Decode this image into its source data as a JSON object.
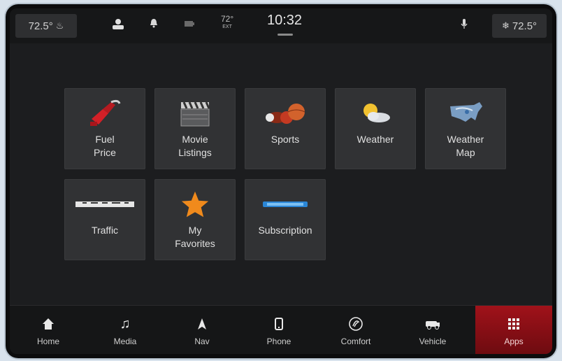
{
  "status": {
    "left_climate_temp": "72.5°",
    "right_climate_temp": "72.5°",
    "outside_temp": "72°",
    "outside_temp_unit": "EXT",
    "time": "10:32"
  },
  "apps": [
    {
      "label": "Fuel\nPrice",
      "icon": "fuel-nozzle-icon"
    },
    {
      "label": "Movie\nListings",
      "icon": "clapperboard-icon"
    },
    {
      "label": "Sports",
      "icon": "sports-balls-icon"
    },
    {
      "label": "Weather",
      "icon": "sun-cloud-icon"
    },
    {
      "label": "Weather\nMap",
      "icon": "us-map-icon"
    },
    {
      "label": "Traffic",
      "icon": "traffic-logo-icon"
    },
    {
      "label": "My\nFavorites",
      "icon": "star-icon"
    },
    {
      "label": "Subscription",
      "icon": "siriusxm-logo-icon"
    }
  ],
  "nav": [
    {
      "label": "Home",
      "icon": "home-icon"
    },
    {
      "label": "Media",
      "icon": "music-note-icon"
    },
    {
      "label": "Nav",
      "icon": "navigation-arrow-icon"
    },
    {
      "label": "Phone",
      "icon": "phone-icon"
    },
    {
      "label": "Comfort",
      "icon": "comfort-icon"
    },
    {
      "label": "Vehicle",
      "icon": "vehicle-icon"
    },
    {
      "label": "Apps",
      "icon": "apps-grid-icon",
      "active": true
    }
  ],
  "colors": {
    "accent_active": "#a0121a",
    "fuel_red": "#d32027",
    "star_orange": "#f08a1c",
    "sxm_blue": "#2a86d6"
  }
}
